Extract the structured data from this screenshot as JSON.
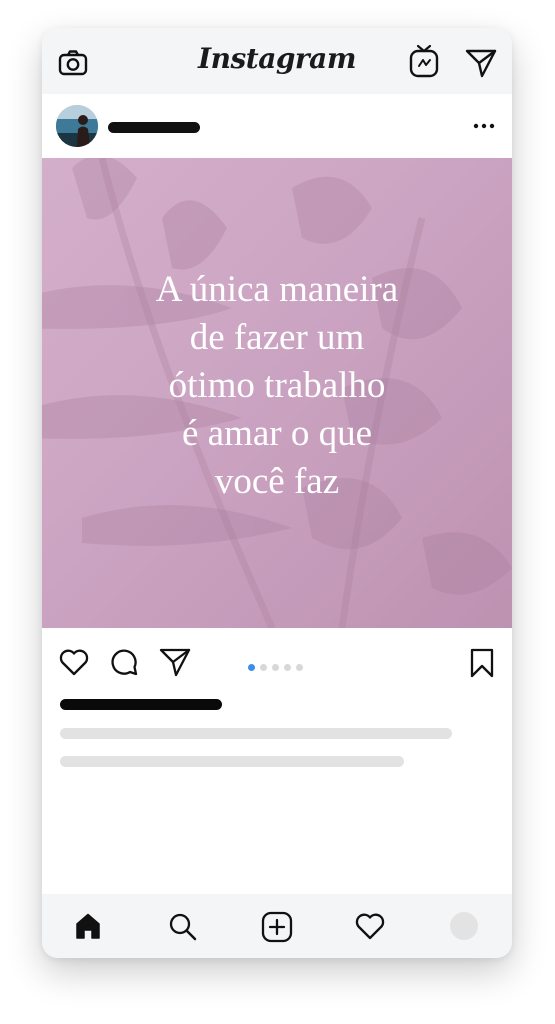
{
  "app": {
    "wordmark": "Instagram",
    "accent_color": "#3b8fe6",
    "post_bg_color": "#cfa8c6"
  },
  "topbar": {
    "left_icon": "camera-icon",
    "right_icons": [
      "igtv-icon",
      "direct-send-icon"
    ]
  },
  "post": {
    "header_icon": "more-options-icon",
    "quote_text": "A única maneira\nde fazer um\nótimo trabalho\né amar o que\nvocê faz",
    "carousel": {
      "count": 5,
      "active_index": 0
    }
  },
  "actions": {
    "icons": [
      "heart-icon",
      "comment-icon",
      "share-icon",
      "bookmark-icon"
    ]
  },
  "bottom_nav": {
    "items": [
      "home-icon",
      "search-icon",
      "new-post-icon",
      "activity-heart-icon",
      "profile-avatar"
    ],
    "active": "home-icon"
  }
}
